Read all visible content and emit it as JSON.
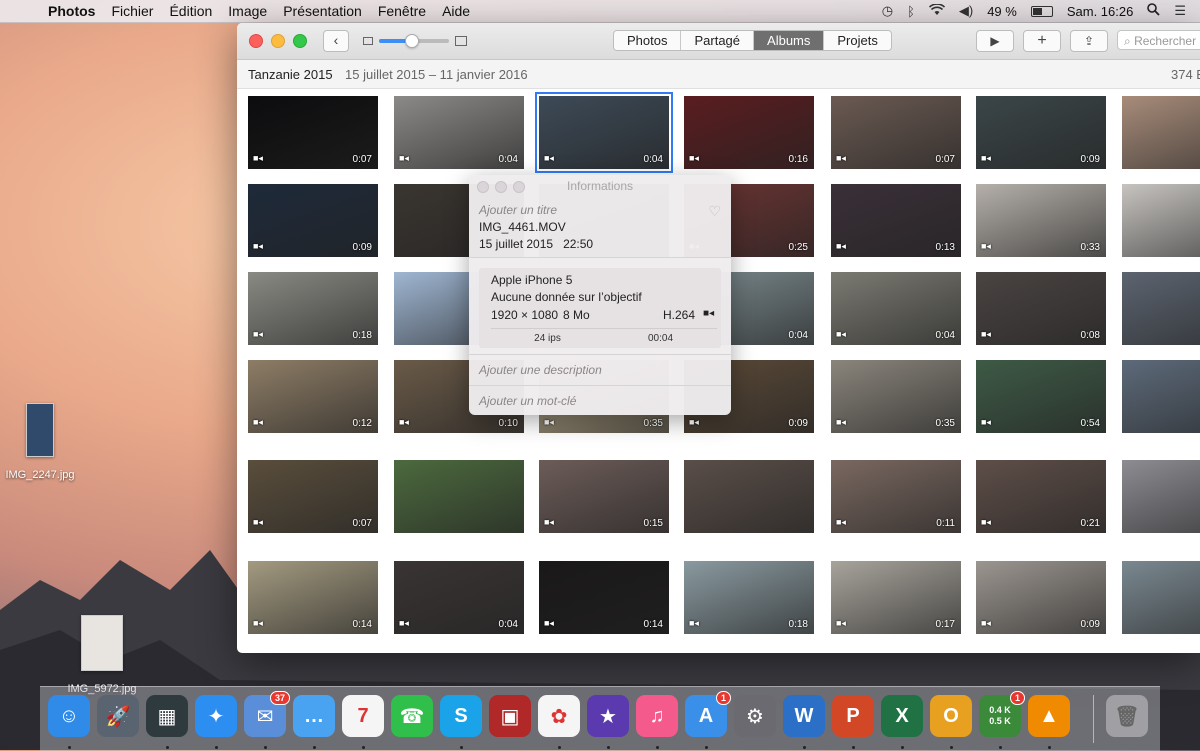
{
  "menubar": {
    "app": "Photos",
    "items": [
      "Fichier",
      "Édition",
      "Image",
      "Présentation",
      "Fenêtre",
      "Aide"
    ],
    "battery": "49 %",
    "clock": "Sam. 16:26"
  },
  "desktop": {
    "icons": [
      {
        "label": "IMG_2247.jpg"
      },
      {
        "label": "IMG_5972.jpg"
      }
    ]
  },
  "toolbar": {
    "segments": [
      "Photos",
      "Partagé",
      "Albums",
      "Projets"
    ],
    "active_segment": "Albums",
    "search_placeholder": "Rechercher",
    "zoom_level": 0.45
  },
  "album": {
    "title": "Tanzanie 2015",
    "dates": "15 juillet 2015 – 11 janvier 2016",
    "count": "374 É"
  },
  "grid": {
    "rows": [
      [
        "0:07",
        "0:04",
        "0:04",
        "0:16",
        "0:07",
        "0:09",
        ""
      ],
      [
        "0:09",
        "",
        "",
        "0:25",
        "0:13",
        "0:33",
        ""
      ],
      [
        "0:18",
        "",
        "",
        "0:04",
        "0:04",
        "0:08",
        ""
      ],
      [
        "0:12",
        "0:10",
        "0:35",
        "0:09",
        "0:35",
        "0:54",
        ""
      ],
      [
        "0:07",
        "",
        "0:15",
        "",
        "0:11",
        "0:21",
        ""
      ],
      [
        "0:14",
        "0:04",
        "0:14",
        "0:18",
        "0:17",
        "0:09",
        ""
      ]
    ],
    "colors": [
      [
        "#0c0c0e",
        "#8c8a88",
        "#3d4a57",
        "#5a1d20",
        "#6b5a52",
        "#3b4648",
        "#a88c7a"
      ],
      [
        "#1e2a3a",
        "#3a3530",
        "#6f6e70",
        "#6a3432",
        "#3a3038",
        "#b5b0aa",
        "#c7c4c0"
      ],
      [
        "#8a8a84",
        "#9fb6d2",
        "#c2c6cc",
        "#7b8a8e",
        "#7b7a72",
        "#4a4442",
        "#5c6470"
      ],
      [
        "#8e7d66",
        "#6a5a48",
        "#c8b896",
        "#5c4a38",
        "#8a857c",
        "#3e5a46",
        "#5d6a7a"
      ],
      [
        "#5a4e3c",
        "#4c6a3e",
        "#6c5c58",
        "#5a4e48",
        "#7a6860",
        "#5e4e48",
        "#8c8c92"
      ],
      [
        "#a39a80",
        "#3a3434",
        "#1a1818",
        "#8a9aa0",
        "#a8a49c",
        "#9c9690",
        "#7a8890"
      ]
    ],
    "selected": [
      0,
      2
    ]
  },
  "info_panel": {
    "window_title": "Informations",
    "add_title": "Ajouter un titre",
    "filename": "IMG_4461.MOV",
    "date": "15 juillet 2015",
    "time": "22:50",
    "device": "Apple iPhone 5",
    "lens": "Aucune donnée sur l’objectif",
    "resolution": "1920 × 1080",
    "size": "8 Mo",
    "codec": "H.264",
    "fps": "24 ips",
    "duration": "00:04",
    "add_description": "Ajouter une description",
    "add_keyword": "Ajouter un mot-clé"
  },
  "dock": {
    "apps": [
      {
        "name": "finder",
        "color": "#2f8ae8",
        "glyph": "☺"
      },
      {
        "name": "launchpad",
        "color": "#5a6470",
        "glyph": "🚀"
      },
      {
        "name": "mission-control",
        "color": "#2e3a3e",
        "glyph": "▦"
      },
      {
        "name": "safari",
        "color": "#2c8ef0",
        "glyph": "✦"
      },
      {
        "name": "mail",
        "color": "#5a8ed8",
        "glyph": "✉",
        "badge": "37"
      },
      {
        "name": "messages",
        "color": "#4aa3f0",
        "glyph": "…"
      },
      {
        "name": "calendar",
        "color": "#f5f5f5",
        "glyph": "7"
      },
      {
        "name": "facetime",
        "color": "#2fbf4a",
        "glyph": "☎"
      },
      {
        "name": "skype",
        "color": "#1aa3e8",
        "glyph": "S"
      },
      {
        "name": "photo-booth",
        "color": "#b02828",
        "glyph": "▣"
      },
      {
        "name": "photos",
        "color": "#f5f5f5",
        "glyph": "✿"
      },
      {
        "name": "imovie",
        "color": "#5b3ab0",
        "glyph": "★"
      },
      {
        "name": "itunes",
        "color": "#f45a8c",
        "glyph": "♫"
      },
      {
        "name": "app-store",
        "color": "#3a90e8",
        "glyph": "A",
        "badge": "1"
      },
      {
        "name": "system-preferences",
        "color": "#6a6a70",
        "glyph": "⚙"
      },
      {
        "name": "word",
        "color": "#2b6fc7",
        "glyph": "W"
      },
      {
        "name": "powerpoint",
        "color": "#d24726",
        "glyph": "P"
      },
      {
        "name": "excel",
        "color": "#207245",
        "glyph": "X"
      },
      {
        "name": "outlook",
        "color": "#e8a020",
        "glyph": "O"
      },
      {
        "name": "network-monitor",
        "color": "#3a8a3a",
        "glyph": "",
        "badge": "1",
        "lines": [
          "0.4 K",
          "0.5 K"
        ]
      },
      {
        "name": "vlc",
        "color": "#f08a00",
        "glyph": "▲"
      }
    ],
    "trash": {
      "name": "trash"
    }
  }
}
